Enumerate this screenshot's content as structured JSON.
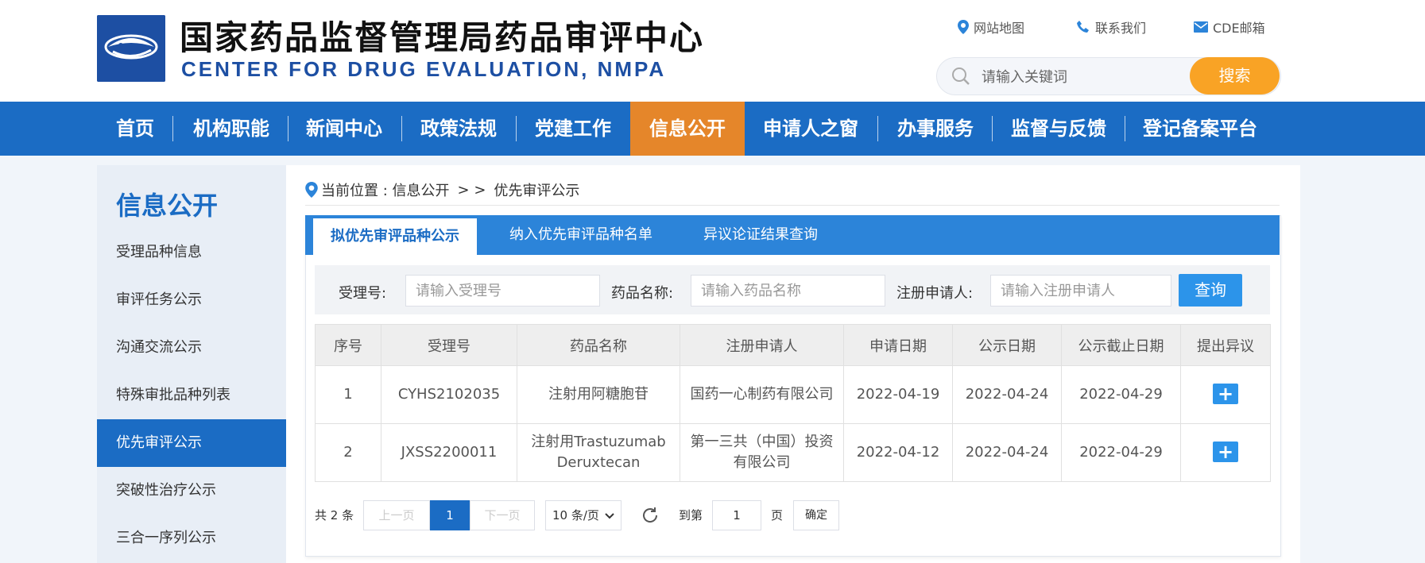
{
  "header": {
    "title": "国家药品监督管理局药品审评中心",
    "subtitle": "CENTER FOR DRUG EVALUATION, NMPA",
    "links": [
      {
        "label": "网站地图",
        "icon": "location-pin-icon"
      },
      {
        "label": "联系我们",
        "icon": "phone-icon"
      },
      {
        "label": "CDE邮箱",
        "icon": "mail-icon"
      }
    ],
    "search_placeholder": "请输入关键词",
    "search_button": "搜索"
  },
  "nav": {
    "items": [
      "首页",
      "机构职能",
      "新闻中心",
      "政策法规",
      "党建工作",
      "信息公开",
      "申请人之窗",
      "办事服务",
      "监督与反馈",
      "登记备案平台"
    ],
    "active": "信息公开"
  },
  "sidebar": {
    "title": "信息公开",
    "items": [
      "受理品种信息",
      "审评任务公示",
      "沟通交流公示",
      "特殊审批品种列表",
      "优先审评公示",
      "突破性治疗公示",
      "三合一序列公示"
    ],
    "active": "优先审评公示"
  },
  "breadcrumb": {
    "prefix": "当前位置 : 信息公开",
    "sep": "> >",
    "current": "优先审评公示"
  },
  "tabs": [
    "拟优先审评品种公示",
    "纳入优先审评品种名单",
    "异议论证结果查询"
  ],
  "filter": {
    "accept_label": "受理号:",
    "accept_placeholder": "请输入受理号",
    "drug_label": "药品名称:",
    "drug_placeholder": "请输入药品名称",
    "applicant_label": "注册申请人:",
    "applicant_placeholder": "请输入注册申请人",
    "query_button": "查询"
  },
  "table": {
    "headers": [
      "序号",
      "受理号",
      "药品名称",
      "注册申请人",
      "申请日期",
      "公示日期",
      "公示截止日期",
      "提出异议"
    ],
    "rows": [
      [
        "1",
        "CYHS2102035",
        "注射用阿糖胞苷",
        "国药一心制药有限公司",
        "2022-04-19",
        "2022-04-24",
        "2022-04-29",
        "+"
      ],
      [
        "2",
        "JXSS2200011",
        "注射用Trastuzumab Deruxtecan",
        "第一三共（中国）投资有限公司",
        "2022-04-12",
        "2022-04-24",
        "2022-04-29",
        "+"
      ]
    ]
  },
  "pagination": {
    "total": "共 2 条",
    "prev": "上一页",
    "page": "1",
    "next": "下一页",
    "page_size": "10 条/页",
    "goto_label": "到第",
    "goto_value": "1",
    "page_unit": "页",
    "confirm": "确定"
  },
  "colors": {
    "brand_blue": "#1b6cc4",
    "active_orange": "#e5862a",
    "search_orange": "#f9a325",
    "button_blue": "#2c94ea"
  }
}
